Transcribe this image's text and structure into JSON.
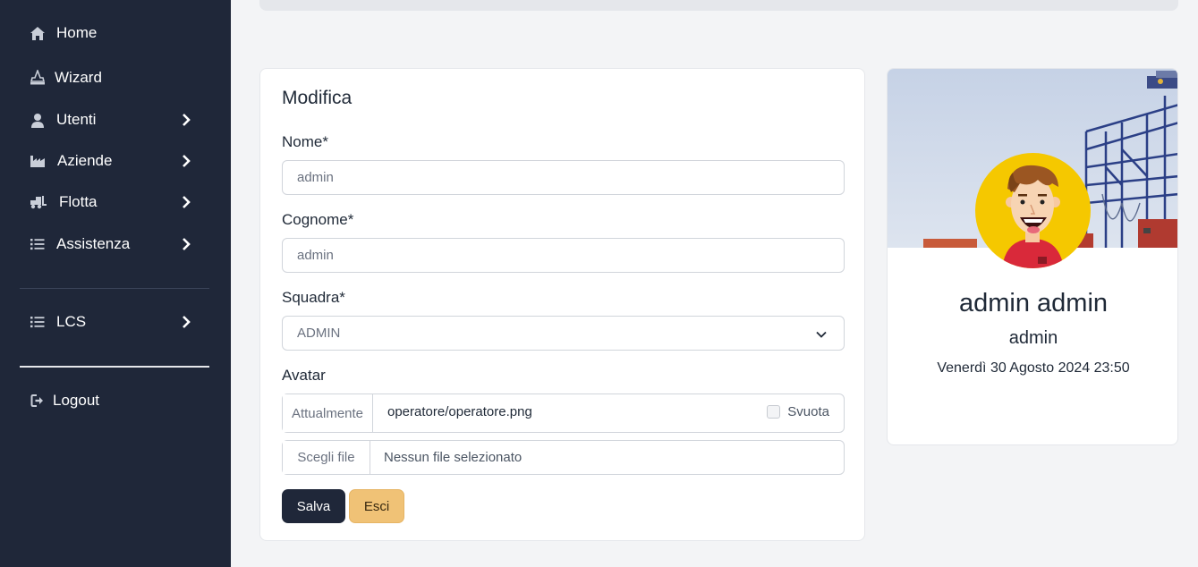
{
  "sidebar": {
    "items": [
      {
        "label": "Home",
        "icon": "home-icon"
      },
      {
        "label": "Wizard",
        "icon": "wizard-icon"
      },
      {
        "label": "Utenti",
        "icon": "user-icon"
      },
      {
        "label": "Aziende",
        "icon": "industry-icon"
      },
      {
        "label": "Flotta",
        "icon": "truck-icon"
      },
      {
        "label": "Assistenza",
        "icon": "list-icon"
      }
    ],
    "lcs": {
      "label": "LCS",
      "icon": "list-icon"
    },
    "logout": {
      "label": "Logout",
      "icon": "logout-icon"
    }
  },
  "form": {
    "title": "Modifica",
    "nome_label": "Nome*",
    "nome_value": "admin",
    "cognome_label": "Cognome*",
    "cognome_value": "admin",
    "squadra_label": "Squadra*",
    "squadra_value": "ADMIN",
    "avatar_label": "Avatar",
    "currently_label": "Attualmente",
    "current_file": "operatore/operatore.png",
    "clear_label": "Svuota",
    "choose_file_label": "Scegli file",
    "no_file_label": "Nessun file selezionato",
    "save_label": "Salva",
    "exit_label": "Esci"
  },
  "profile": {
    "full_name": "admin admin",
    "username": "admin",
    "datetime": "Venerdì 30 Agosto 2024 23:50"
  },
  "colors": {
    "sidebar_bg": "#1f2739",
    "save_button": "#1f2739",
    "exit_button": "#f0c276",
    "avatar_bg": "#f5c800"
  }
}
